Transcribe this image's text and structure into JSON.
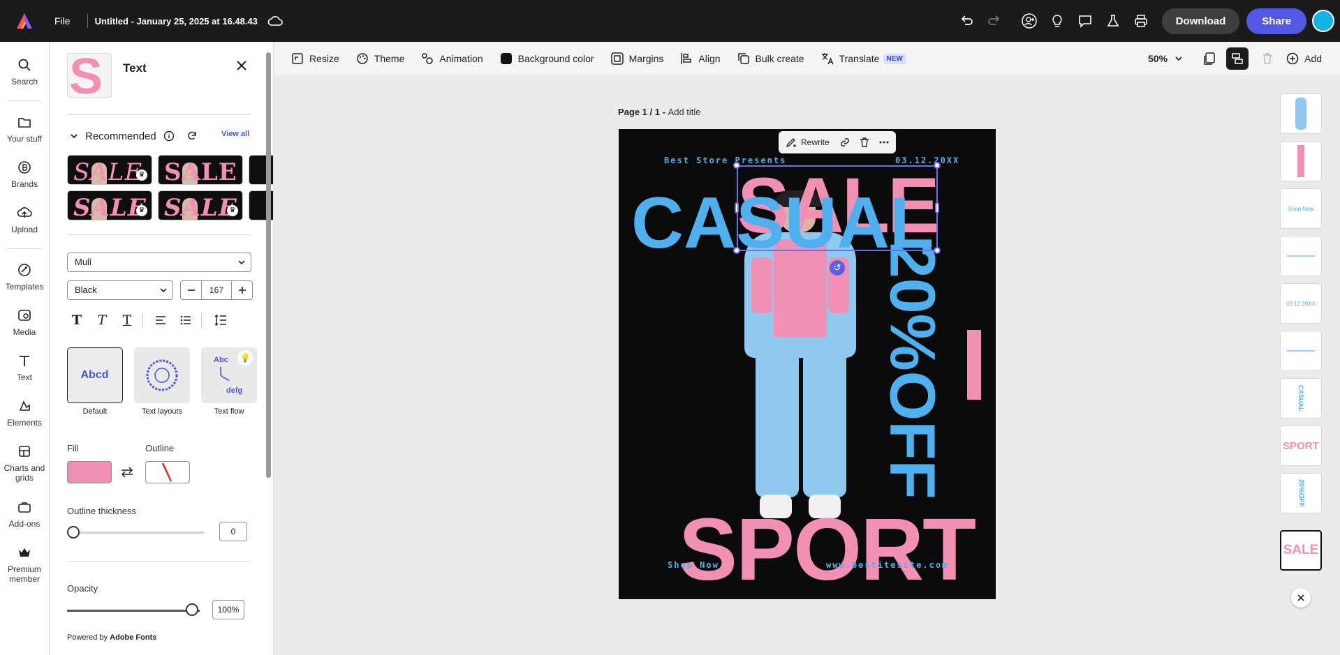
{
  "topbar": {
    "file_label": "File",
    "doc_title": "Untitled - January 25, 2025 at 16.48.43",
    "download_label": "Download",
    "share_label": "Share"
  },
  "rail": [
    {
      "label": "Search",
      "icon": "search-icon"
    },
    {
      "label": "Your stuff",
      "icon": "folder-icon"
    },
    {
      "label": "Brands",
      "icon": "brand-icon"
    },
    {
      "label": "Upload",
      "icon": "upload-icon"
    },
    {
      "label": "Templates",
      "icon": "templates-icon"
    },
    {
      "label": "Media",
      "icon": "media-icon"
    },
    {
      "label": "Text",
      "icon": "text-icon"
    },
    {
      "label": "Elements",
      "icon": "elements-icon"
    },
    {
      "label": "Charts and grids",
      "icon": "charts-icon"
    },
    {
      "label": "Add-ons",
      "icon": "addons-icon"
    },
    {
      "label": "Premium member",
      "icon": "crown-icon"
    }
  ],
  "panel": {
    "title": "Text",
    "recommended_title": "Recommended",
    "view_all": "View all",
    "preset_text": "SALE",
    "font_family": "Muli",
    "font_weight": "Black",
    "font_size": "167",
    "cards": [
      {
        "label": "Default",
        "preview": "Abcd"
      },
      {
        "label": "Text layouts",
        "preview": "ABCDEFGHIJKL"
      },
      {
        "label": "Text flow",
        "preview_top": "Abc",
        "preview_bottom": "defg"
      }
    ],
    "fill_label": "Fill",
    "outline_label": "Outline",
    "fill_color": "#f28fb4",
    "outline_thickness_label": "Outline thickness",
    "outline_thickness_value": "0",
    "opacity_label": "Opacity",
    "opacity_value": "100%",
    "powered_prefix": "Powered by ",
    "powered_brand": "Adobe Fonts"
  },
  "toolbar": {
    "items": [
      {
        "label": "Resize",
        "icon": "resize-icon"
      },
      {
        "label": "Theme",
        "icon": "theme-icon"
      },
      {
        "label": "Animation",
        "icon": "animation-icon"
      },
      {
        "label": "Background color",
        "icon": "bg-color-icon"
      },
      {
        "label": "Margins",
        "icon": "margins-icon"
      },
      {
        "label": "Align",
        "icon": "align-icon"
      },
      {
        "label": "Bulk create",
        "icon": "bulk-icon"
      },
      {
        "label": "Translate",
        "icon": "translate-icon"
      }
    ],
    "new_badge": "NEW",
    "zoom": "50%",
    "add_label": "Add"
  },
  "canvas": {
    "page_prefix": "Page 1 / 1 - ",
    "page_title_placeholder": "Add title",
    "context_rewrite": "Rewrite",
    "poster": {
      "store": "Best Store Presents",
      "date": "03.12.20XX",
      "sale": "SALE",
      "casual": "CASUAL",
      "discount": "20%OFF",
      "sport": "SPORT",
      "shop": "Shop Now",
      "site": "www.bestitesite.com"
    },
    "accent_pink": "#f28fb4",
    "accent_blue": "#4fb0ef"
  },
  "strip": [
    {
      "label": ""
    },
    {
      "label": ""
    },
    {
      "label": "Shop Now"
    },
    {
      "label": ""
    },
    {
      "label": "03.12.20XX"
    },
    {
      "label": ""
    },
    {
      "label": "CASUAL"
    },
    {
      "label": "SPORT"
    },
    {
      "label": "20%OFF"
    },
    {
      "label": "SALE"
    }
  ]
}
